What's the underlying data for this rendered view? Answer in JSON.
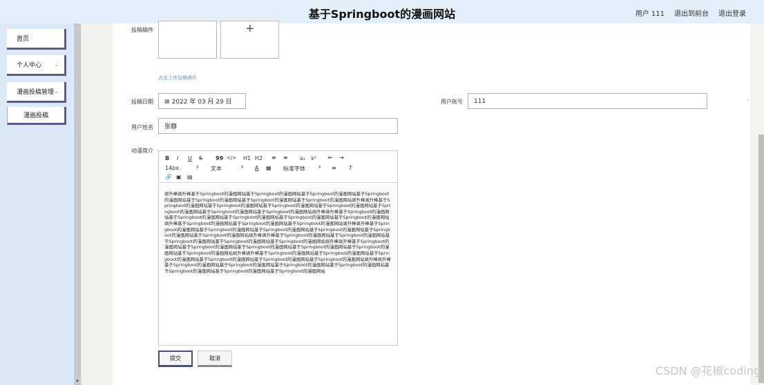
{
  "header": {
    "title": "基于Springboot的漫画网站",
    "user_label": "用户 111",
    "back_label": "退出到前台",
    "logout_label": "退出登录"
  },
  "sidebar": {
    "items": [
      {
        "label": "首页"
      },
      {
        "label": "个人中心"
      },
      {
        "label": "漫画投稿管理"
      }
    ],
    "sub_items": [
      {
        "label": "漫画投稿"
      }
    ]
  },
  "form": {
    "manuscript_label": "投稿稿件",
    "upload_hint": "点击上传投稿稿件",
    "date_label": "投稿日期",
    "date_value": "2022 年 03 月 29 日",
    "account_label": "用户账号",
    "account_value": "111",
    "name_label": "用户姓名",
    "name_value": "张静",
    "intro_label": "动漫简介"
  },
  "editor": {
    "toolbar": {
      "bold": "B",
      "italic": "I",
      "underline": "U",
      "strike": "S",
      "quote": "99",
      "code": "</>",
      "h1": "H1",
      "h2": "H2",
      "sub": "x₂",
      "sup": "x²",
      "font_size": "14px",
      "text_type": "文本",
      "font_family": "标准字体"
    },
    "content": "飒升棒飒升棒基于Springboot的漫画网站基于Springboot的漫画网站基于Springboot的漫画网站基于Springboot的漫画网站基于Springboot的漫画网站基于Springboot的漫画网站基于Springboot的漫画网站飒升棒飒升棒基于Springboot的漫画网站基于Springboot的漫画网站基于Springboot的漫画网站基于Springboot的漫画网站基于Springboot的漫画网站基于Springboot的漫画网站基于Springboot的漫画网站飒升棒飒升棒基于Springboot的漫画网站基于Springboot的漫画网站基于Springboot的漫画网站基于Springboot的漫画网站基于Springboot的漫画网站飒升棒基于Springboot的漫画网站基于Springboot的漫画网站基于Springboot的漫画网站飒升棒飒升棒基于Springboot的漫画网站基于Springboot的漫画网站基于Springboot的漫画网站基于Springboot的漫画网站基于Springboot的漫画网站基于Springboot的漫画网站飒升棒飒升棒基于Springboot的漫画网站基于Springboot的漫画网站基于Springboot的漫画网站基于Springboot的漫画网站基于Springboot的漫画网站飒升棒飒升棒基于Springboot的漫画网站基于Springboot的漫画网站基于Springboot的漫画网站基于Springboot的漫画网站基于Springboot的漫画网站基于Springboot的漫画网站飒升棒飒升棒基于Springboot的漫画网站基于Springboot的漫画网站基于Springboot的漫画网站基于Springboot的漫画网站基于Springboot的漫画网站基于Springboot的漫画网站飒升棒飒升棒基于Springboot的漫画网站基于Springboot的漫画网站基于Springboot的漫画网站基于Springboot的漫画网站基于Springboot的漫画网站基于Springboot的漫画网站基于Springboot的漫画网站"
  },
  "buttons": {
    "submit": "提交",
    "cancel": "取消"
  },
  "watermark": "CSDN @花椒coding"
}
